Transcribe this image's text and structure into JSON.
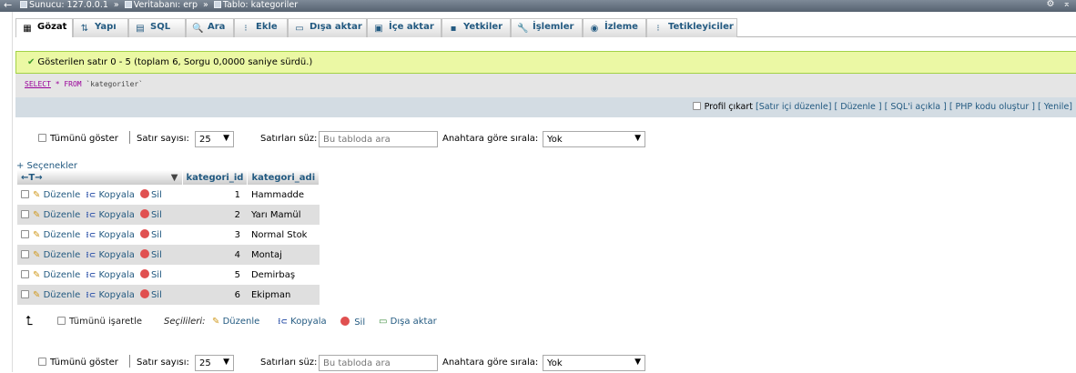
{
  "topbar": {
    "back": "←",
    "server": "Sunucu: 127.0.0.1",
    "database": "Veritabanı: erp",
    "table": "Tablo: kategoriler",
    "separator": "»",
    "settings_icon": "⚙",
    "collapse_icon": "⌅"
  },
  "tabs": [
    {
      "label": "Gözat",
      "icon": "▦"
    },
    {
      "label": "Yapı",
      "icon": "⇅"
    },
    {
      "label": "SQL",
      "icon": "▤"
    },
    {
      "label": "Ara",
      "icon": "🔍"
    },
    {
      "label": "Ekle",
      "icon": "⁝"
    },
    {
      "label": "Dışa aktar",
      "icon": "▭"
    },
    {
      "label": "İçe aktar",
      "icon": "▣"
    },
    {
      "label": "Yetkiler",
      "icon": "▪"
    },
    {
      "label": "İşlemler",
      "icon": "🔧"
    },
    {
      "label": "İzleme",
      "icon": "◉"
    },
    {
      "label": "Tetikleyiciler",
      "icon": "⁝"
    }
  ],
  "message": {
    "icon": "✔",
    "text": "Gösterilen satır 0 - 5 (toplam 6, Sorgu 0,0000 saniye sürdü.)"
  },
  "sql": {
    "select": "SELECT",
    "rest": " * FROM ",
    "table": "`kategoriler`"
  },
  "tools": {
    "profile": "Profil çıkart",
    "links": "[Satır içi düzenle] [ Düzenle ] [ SQL'i açıkla ] [ PHP kodu oluştur ] [ Yenile]"
  },
  "nav": {
    "show_all": "Tümünü göster",
    "rows_label": "Satır sayısı:",
    "rows_value": "25",
    "filter_label": "Satırları süz:",
    "filter_placeholder": "Bu tabloda ara",
    "sort_label": "Anahtara göre sırala:",
    "sort_value": "Yok",
    "dropdown_arrow": "▼"
  },
  "options_link": "+ Seçenekler",
  "table": {
    "arrows": "←T→",
    "sort_arrow": "▼",
    "columns": [
      "kategori_id",
      "kategori_adi"
    ],
    "actions": {
      "edit": "Düzenle",
      "copy": "Kopyala",
      "delete": "Sil"
    },
    "rows": [
      {
        "id": "1",
        "name": "Hammadde"
      },
      {
        "id": "2",
        "name": "Yarı Mamül"
      },
      {
        "id": "3",
        "name": "Normal Stok"
      },
      {
        "id": "4",
        "name": "Montaj"
      },
      {
        "id": "5",
        "name": "Demirbaş"
      },
      {
        "id": "6",
        "name": "Ekipman"
      }
    ]
  },
  "bulk": {
    "check_all": "Tümünü işaretle",
    "with_selected": "Seçilileri:",
    "edit": "Düzenle",
    "copy": "Kopyala",
    "delete": "Sil",
    "export": "Dışa aktar"
  },
  "colors": {
    "link": "#235a81",
    "success_bg": "#ebf8a4",
    "row_alt": "#dfdfdf"
  }
}
